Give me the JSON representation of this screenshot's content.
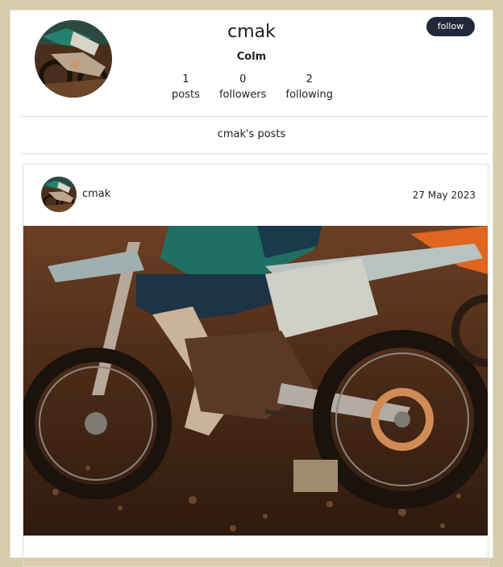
{
  "profile": {
    "username": "cmak",
    "full_name": "Colm",
    "follow_label": "follow",
    "stats": [
      {
        "count": "1",
        "label": "posts"
      },
      {
        "count": "0",
        "label": "followers"
      },
      {
        "count": "2",
        "label": "following"
      }
    ]
  },
  "posts_section": {
    "heading": "cmak's posts"
  },
  "post": {
    "author": "cmak",
    "date": "27 May 2023"
  },
  "colors": {
    "page_background": "#d8ccab",
    "button_background": "#222839"
  }
}
